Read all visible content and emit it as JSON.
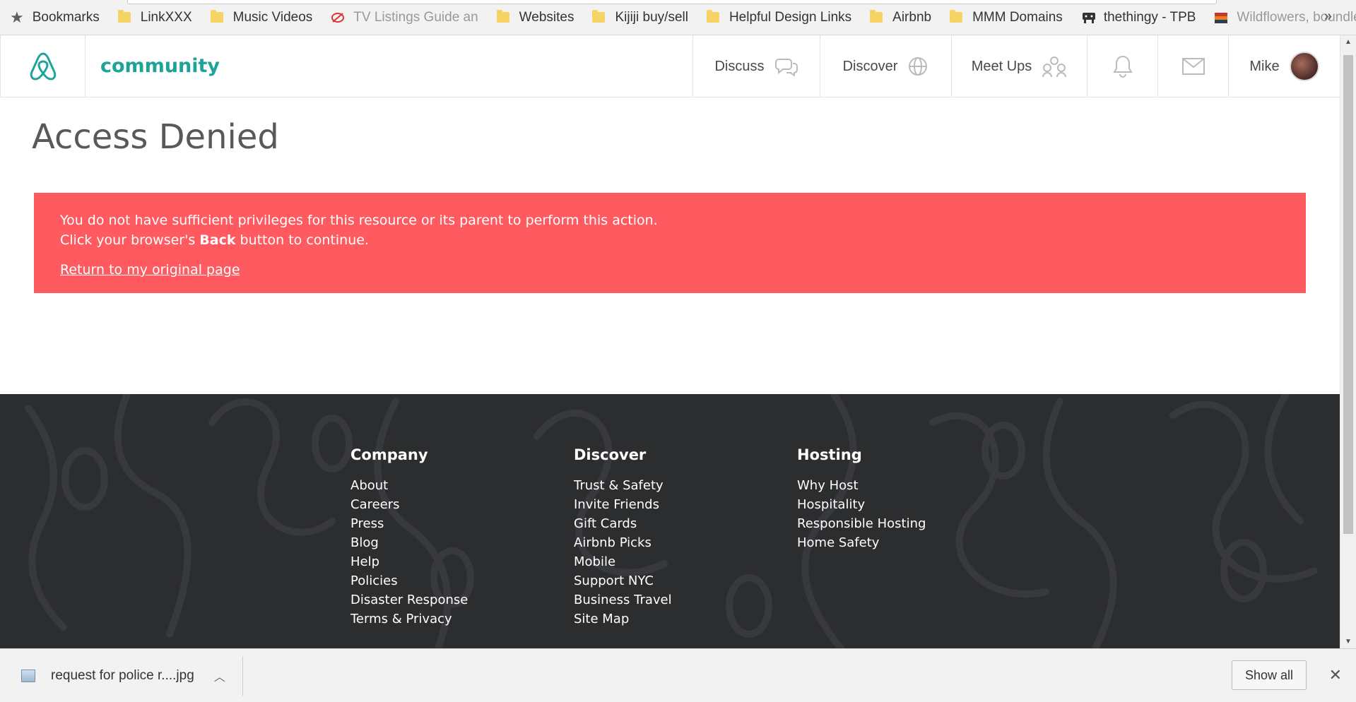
{
  "bookmarks": {
    "items": [
      {
        "label": "Bookmarks",
        "icon": "star-icon"
      },
      {
        "label": "LinkXXX",
        "icon": "folder-icon"
      },
      {
        "label": "Music Videos",
        "icon": "folder-icon"
      },
      {
        "label": "TV Listings Guide an",
        "icon": "site-favicon"
      },
      {
        "label": "Websites",
        "icon": "folder-icon"
      },
      {
        "label": "Kijiji buy/sell",
        "icon": "folder-icon"
      },
      {
        "label": "Helpful Design Links",
        "icon": "folder-icon"
      },
      {
        "label": "Airbnb",
        "icon": "folder-icon"
      },
      {
        "label": "MMM Domains",
        "icon": "folder-icon"
      },
      {
        "label": "thethingy - TPB",
        "icon": "site-favicon"
      },
      {
        "label": "Wildflowers, boundle",
        "icon": "site-favicon"
      }
    ],
    "more": "»"
  },
  "header": {
    "brand": "community",
    "nav": [
      {
        "label": "Discuss",
        "icon": "chat-bubbles-icon"
      },
      {
        "label": "Discover",
        "icon": "globe-icon"
      },
      {
        "label": "Meet Ups",
        "icon": "people-icon"
      }
    ],
    "user": "Mike",
    "accent": "#1ea39a"
  },
  "main": {
    "title": "Access Denied",
    "alert": {
      "line1": "You do not have sufficient privileges for this resource or its parent to perform this action.",
      "line2_pre": "Click your browser's ",
      "line2_bold": "Back",
      "line2_post": " button to continue.",
      "link": "Return to my original page",
      "color": "#ff5a5f"
    }
  },
  "footer": {
    "columns": [
      {
        "heading": "Company",
        "links": [
          "About",
          "Careers",
          "Press",
          "Blog",
          "Help",
          "Policies",
          "Disaster Response",
          "Terms & Privacy"
        ]
      },
      {
        "heading": "Discover",
        "links": [
          "Trust & Safety",
          "Invite Friends",
          "Gift Cards",
          "Airbnb Picks",
          "Mobile",
          "Support NYC",
          "Business Travel",
          "Site Map"
        ]
      },
      {
        "heading": "Hosting",
        "links": [
          "Why Host",
          "Hospitality",
          "Responsible Hosting",
          "Home Safety"
        ]
      }
    ]
  },
  "downloads": {
    "file": "request for police r....jpg",
    "show_all": "Show all",
    "close": "✕"
  }
}
